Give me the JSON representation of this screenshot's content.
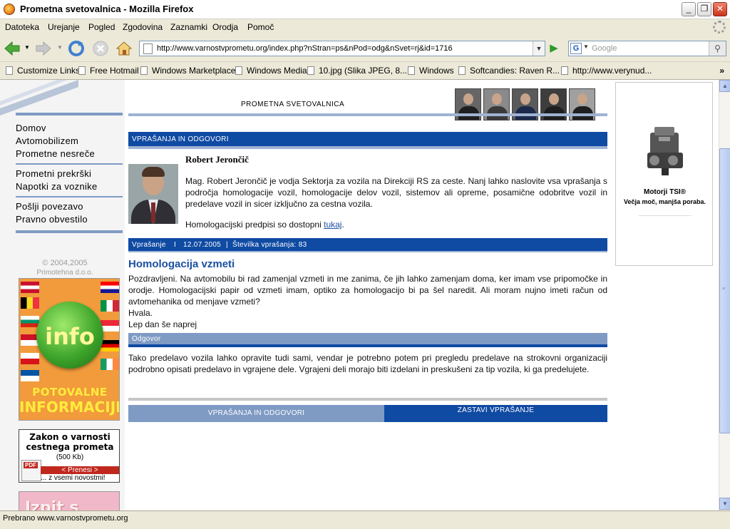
{
  "window": {
    "title": "Prometna svetovalnica - Mozilla Firefox"
  },
  "menu": [
    "Datoteka",
    "Urejanje",
    "Pogled",
    "Zgodovina",
    "Zaznamki",
    "Orodja",
    "Pomoč"
  ],
  "nav": {
    "url": "http://www.varnostvprometu.org/index.php?nStran=ps&nPod=odg&nSvet=rj&id=1716",
    "search_placeholder": "Google"
  },
  "bookmarks": [
    "Customize Links",
    "Free Hotmail",
    "Windows Marketplace",
    "Windows Media",
    "10.jpg (Slika JPEG, 8...",
    "Windows",
    "Softcandies: Raven R...",
    "http://www.verynud..."
  ],
  "sidebar": {
    "group1": [
      "Domov",
      "Avtomobilizem",
      "Prometne nesreče"
    ],
    "group2": [
      "Prometni prekrški",
      "Napotki za voznike"
    ],
    "group3": [
      "Pošlji povezavo",
      "Pravno obvestilo"
    ],
    "copyright_line1": "© 2004,2005",
    "copyright_line2": "Primotehna d.o.o.",
    "info_banner": {
      "word": "info",
      "line1": "POTOVALNE",
      "line2": "INFORMACIJE"
    },
    "zakon": {
      "title_line1": "Zakon o varnosti",
      "title_line2": "cestnega prometa",
      "size": "(500 Kb)",
      "download": "< Prenesi >",
      "news": "... z vsemi novostmi!"
    },
    "izpit": "Izpit s"
  },
  "main": {
    "header_title": "PROMETNA SVETOVALNICA",
    "section_title": "VPRAŠANJA IN ODGOVORI",
    "person": {
      "name": "Robert Jerončič",
      "description": "Mag. Robert Jerončič je vodja Sektorja za vozila na Direkciji RS za ceste. Nanj lahko naslovite vsa vprašanja s področja homologacije vozil, homologacije delov vozil, sistemov ali opreme, posamične odobritve vozil in predelave vozil in sicer izključno za cestna vozila.",
      "link_prefix": "Homologacijski predpisi so dostopni ",
      "link_text": "tukaj",
      "link_suffix": "."
    },
    "question_bar": {
      "label": "Vprašanje",
      "sep1": "I",
      "date": "12.07.2005",
      "sep2": "|",
      "number_label": "Številka vprašanja: 83"
    },
    "question_title": "Homologacija vzmeti",
    "question_text": "Pozdravljeni. Na avtomobilu bi rad zamenjal vzmeti in me zanima, če jih lahko zamenjam doma, ker imam vse pripomočke in orodje. Homologacijski papir od vzmeti imam, optiko za homologacijo bi pa šel naredit. Ali moram nujno imeti račun od avtomehanika od menjave vzmeti?",
    "question_thanks": "Hvala.",
    "question_greeting": "Lep dan še naprej",
    "answer_label": "Odgovor",
    "answer_text": "Tako predelavo vozila lahko opravite tudi sami, vendar je potrebno potem pri pregledu predelave na strokovni organizaciji podrobno opisati predelavo in vgrajene dele. Vgrajeni deli morajo biti izdelani in preskušeni za tip vozila, ki ga predelujete.",
    "bottom_left": "VPRAŠANJA IN ODGOVORI",
    "bottom_right": "ZASTAVI VPRAŠANJE"
  },
  "ad": {
    "brand": "Motorji TSI®",
    "slogan": "Večja moč, manjša poraba."
  },
  "status": "Prebrano www.varnostvprometu.org"
}
